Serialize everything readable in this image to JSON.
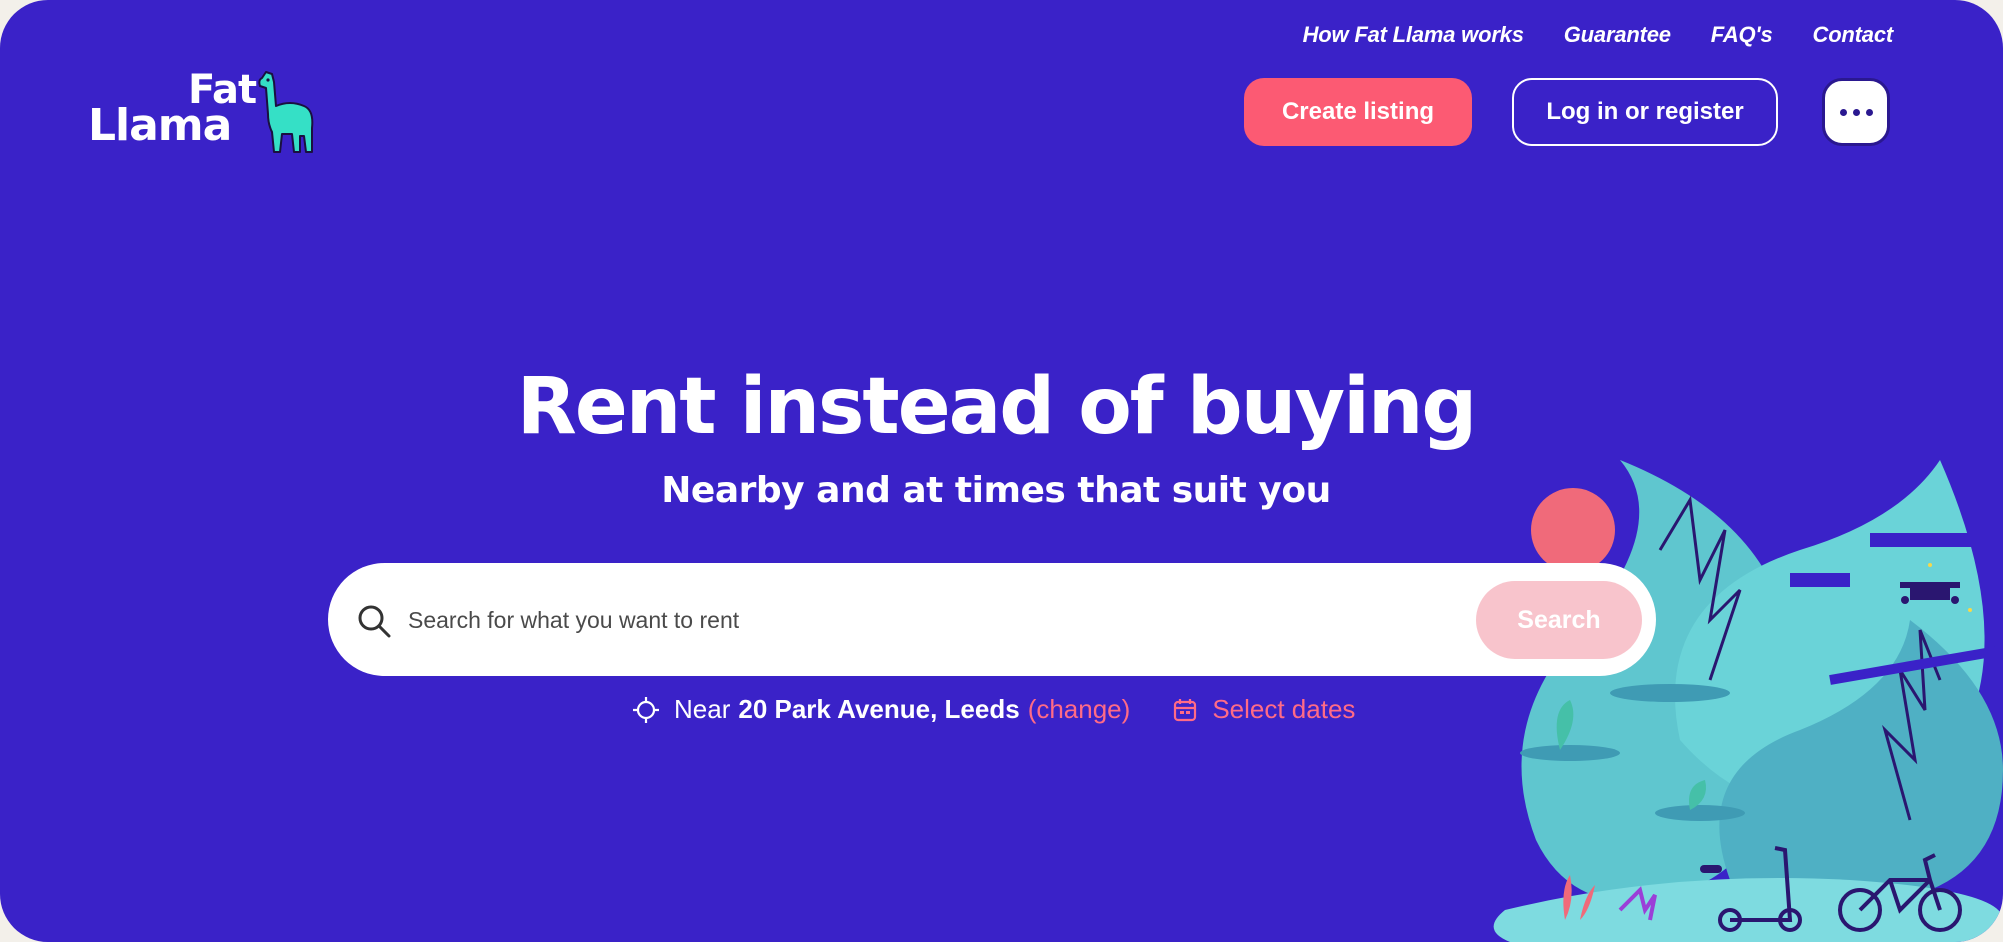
{
  "nav": {
    "links": [
      "How Fat Llama works",
      "Guarantee",
      "FAQ's",
      "Contact"
    ]
  },
  "logo": {
    "line1": "Fat",
    "line2": "Llama"
  },
  "header": {
    "create_listing": "Create listing",
    "login": "Log in or register"
  },
  "hero": {
    "title": "Rent instead of buying",
    "subtitle": "Nearby and at times that suit you"
  },
  "search": {
    "placeholder": "Search for what you want to rent",
    "button": "Search"
  },
  "location": {
    "prefix": "Near",
    "address": "20 Park Avenue, Leeds",
    "change": "(change)"
  },
  "dates": {
    "label": "Select dates"
  },
  "colors": {
    "background": "#3a22c8",
    "accent": "#fc5a73",
    "illustration": "#5fc6cf"
  },
  "icons": {
    "search": "search-icon",
    "location": "crosshair-icon",
    "calendar": "calendar-icon",
    "more": "more-dots-icon"
  }
}
